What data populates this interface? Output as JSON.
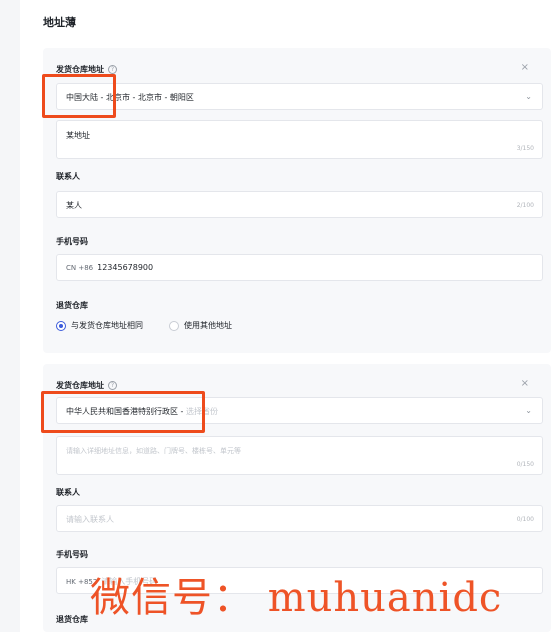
{
  "page": {
    "title": "地址薄"
  },
  "card1": {
    "warehouse_label": "发货仓库地址",
    "help_icon": "?",
    "close_icon": "×",
    "region": "中国大陆 - 北京市 - 北京市 - 朝阳区",
    "detail_address": "某地址",
    "detail_counter": "3/150",
    "contact_label": "联系人",
    "contact_value": "某人",
    "contact_counter": "2/100",
    "phone_label": "手机号码",
    "phone_prefix": "CN +86",
    "phone_value": "12345678900",
    "return_label": "退货仓库",
    "return_options": [
      {
        "label": "与发货仓库地址相同",
        "checked": true
      },
      {
        "label": "使用其他地址",
        "checked": false
      }
    ]
  },
  "card2": {
    "warehouse_label": "发货仓库地址",
    "help_icon": "?",
    "close_icon": "×",
    "region": "中华人民共和国香港特别行政区 -",
    "region_placeholder": "选择省份",
    "detail_placeholder": "请输入详细地址信息，如道路、门牌号、楼栋号、单元等",
    "detail_counter": "0/150",
    "contact_label": "联系人",
    "contact_placeholder": "请输入联系人",
    "contact_counter": "0/100",
    "phone_label": "手机号码",
    "phone_prefix": "HK +852",
    "phone_placeholder": "请输入手机号码",
    "return_label": "退货仓库"
  },
  "watermark": "微信号： muhuanidc",
  "colors": {
    "highlight": "#ee4b1c",
    "radio_checked": "#3b5bdb"
  }
}
